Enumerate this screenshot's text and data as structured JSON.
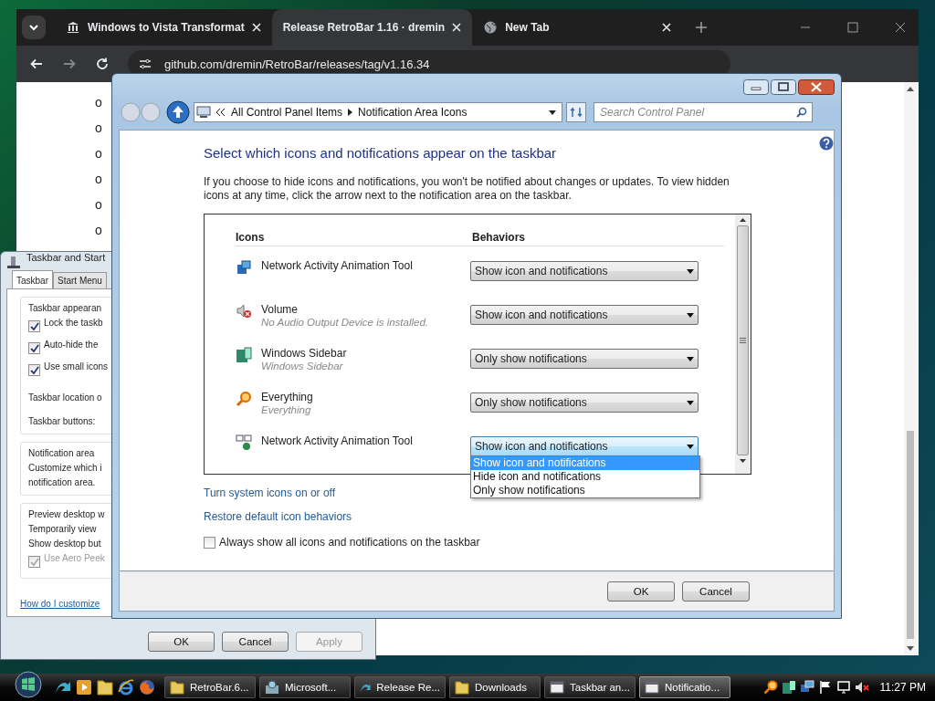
{
  "browser": {
    "tabs": [
      {
        "title": "Windows to Vista Transformat",
        "selected": false
      },
      {
        "title": "Release RetroBar 1.16 · dremin",
        "selected": true
      },
      {
        "title": "New Tab",
        "selected": false
      }
    ],
    "address": "github.com/dremin/RetroBar/releases/tag/v1.16.34",
    "bullets": [
      "o",
      "o",
      "o",
      "o",
      "o",
      "o"
    ]
  },
  "taskbar_dialog": {
    "title": "Taskbar and Start",
    "tabs": [
      {
        "label": "Taskbar",
        "selected": true
      },
      {
        "label": "Start Menu",
        "selected": false
      }
    ],
    "appearance_group": "Taskbar appearan",
    "checkboxes": [
      {
        "label": "Lock the taskb",
        "checked": true
      },
      {
        "label": "Auto-hide the",
        "checked": true
      },
      {
        "label": "Use small icons",
        "checked": true
      }
    ],
    "location_label": "Taskbar location o",
    "buttons_label": "Taskbar buttons:",
    "notification_group": "Notification area",
    "notification_text": [
      "Customize which i",
      "notification area."
    ],
    "preview_group": "Preview desktop w",
    "preview_text": [
      "Temporarily view",
      "Show desktop but"
    ],
    "peek": {
      "label": "Use Aero Peek",
      "checked": true,
      "disabled": true
    },
    "help_link": "How do I customize",
    "buttons": [
      {
        "label": "OK",
        "disabled": false
      },
      {
        "label": "Cancel",
        "disabled": false
      },
      {
        "label": "Apply",
        "disabled": true
      }
    ]
  },
  "notification_dialog": {
    "breadcrumb": [
      "All Control Panel Items",
      "Notification Area Icons"
    ],
    "search": {
      "placeholder": "Search Control Panel"
    },
    "heading": "Select which icons and notifications appear on the taskbar",
    "description": "If you choose to hide icons and notifications, you won't be notified about changes or updates. To view hidden icons at any time, click the arrow next to the notification area on the taskbar.",
    "columns": [
      "Icons",
      "Behaviors"
    ],
    "rows": [
      {
        "kind": "network",
        "name": "Network Activity Animation Tool",
        "behavior": "Show icon and notifications",
        "expanded": false
      },
      {
        "kind": "volume",
        "name": "Volume",
        "subtitle": "No Audio Output Device is installed.",
        "behavior": "Show icon and notifications",
        "expanded": false
      },
      {
        "kind": "sidebar",
        "name": "Windows Sidebar",
        "subtitle": "Windows Sidebar",
        "behavior": "Only show notifications",
        "expanded": false
      },
      {
        "kind": "magnifier",
        "name": "Everything",
        "subtitle": "Everything",
        "behavior": "Only show notifications",
        "expanded": false
      },
      {
        "kind": "monitors",
        "name": "Network Activity Animation Tool",
        "behavior": "Show icon and notifications",
        "expanded": true,
        "options": [
          {
            "label": "Show icon and notifications",
            "selected": true
          },
          {
            "label": "Hide icon and notifications",
            "selected": false
          },
          {
            "label": "Only show notifications",
            "selected": false
          }
        ]
      }
    ],
    "links": [
      "Turn system icons on or off",
      "Restore default icon behaviors"
    ],
    "always_show": {
      "label": "Always show all icons and notifications on the taskbar",
      "checked": false
    },
    "buttons": [
      "OK",
      "Cancel"
    ]
  },
  "taskbar": {
    "items": [
      {
        "kind": "folder",
        "label": "RetroBar.6...",
        "active": false
      },
      {
        "kind": "installer",
        "label": "Microsoft...",
        "active": false
      },
      {
        "kind": "arrow",
        "label": "Release Re...",
        "active": false
      },
      {
        "kind": "folder",
        "label": "Downloads",
        "active": false
      },
      {
        "kind": "window",
        "label": "Taskbar an...",
        "active": false
      },
      {
        "kind": "window",
        "label": "Notificatio...",
        "active": true
      }
    ],
    "clock": "11:27 PM"
  }
}
